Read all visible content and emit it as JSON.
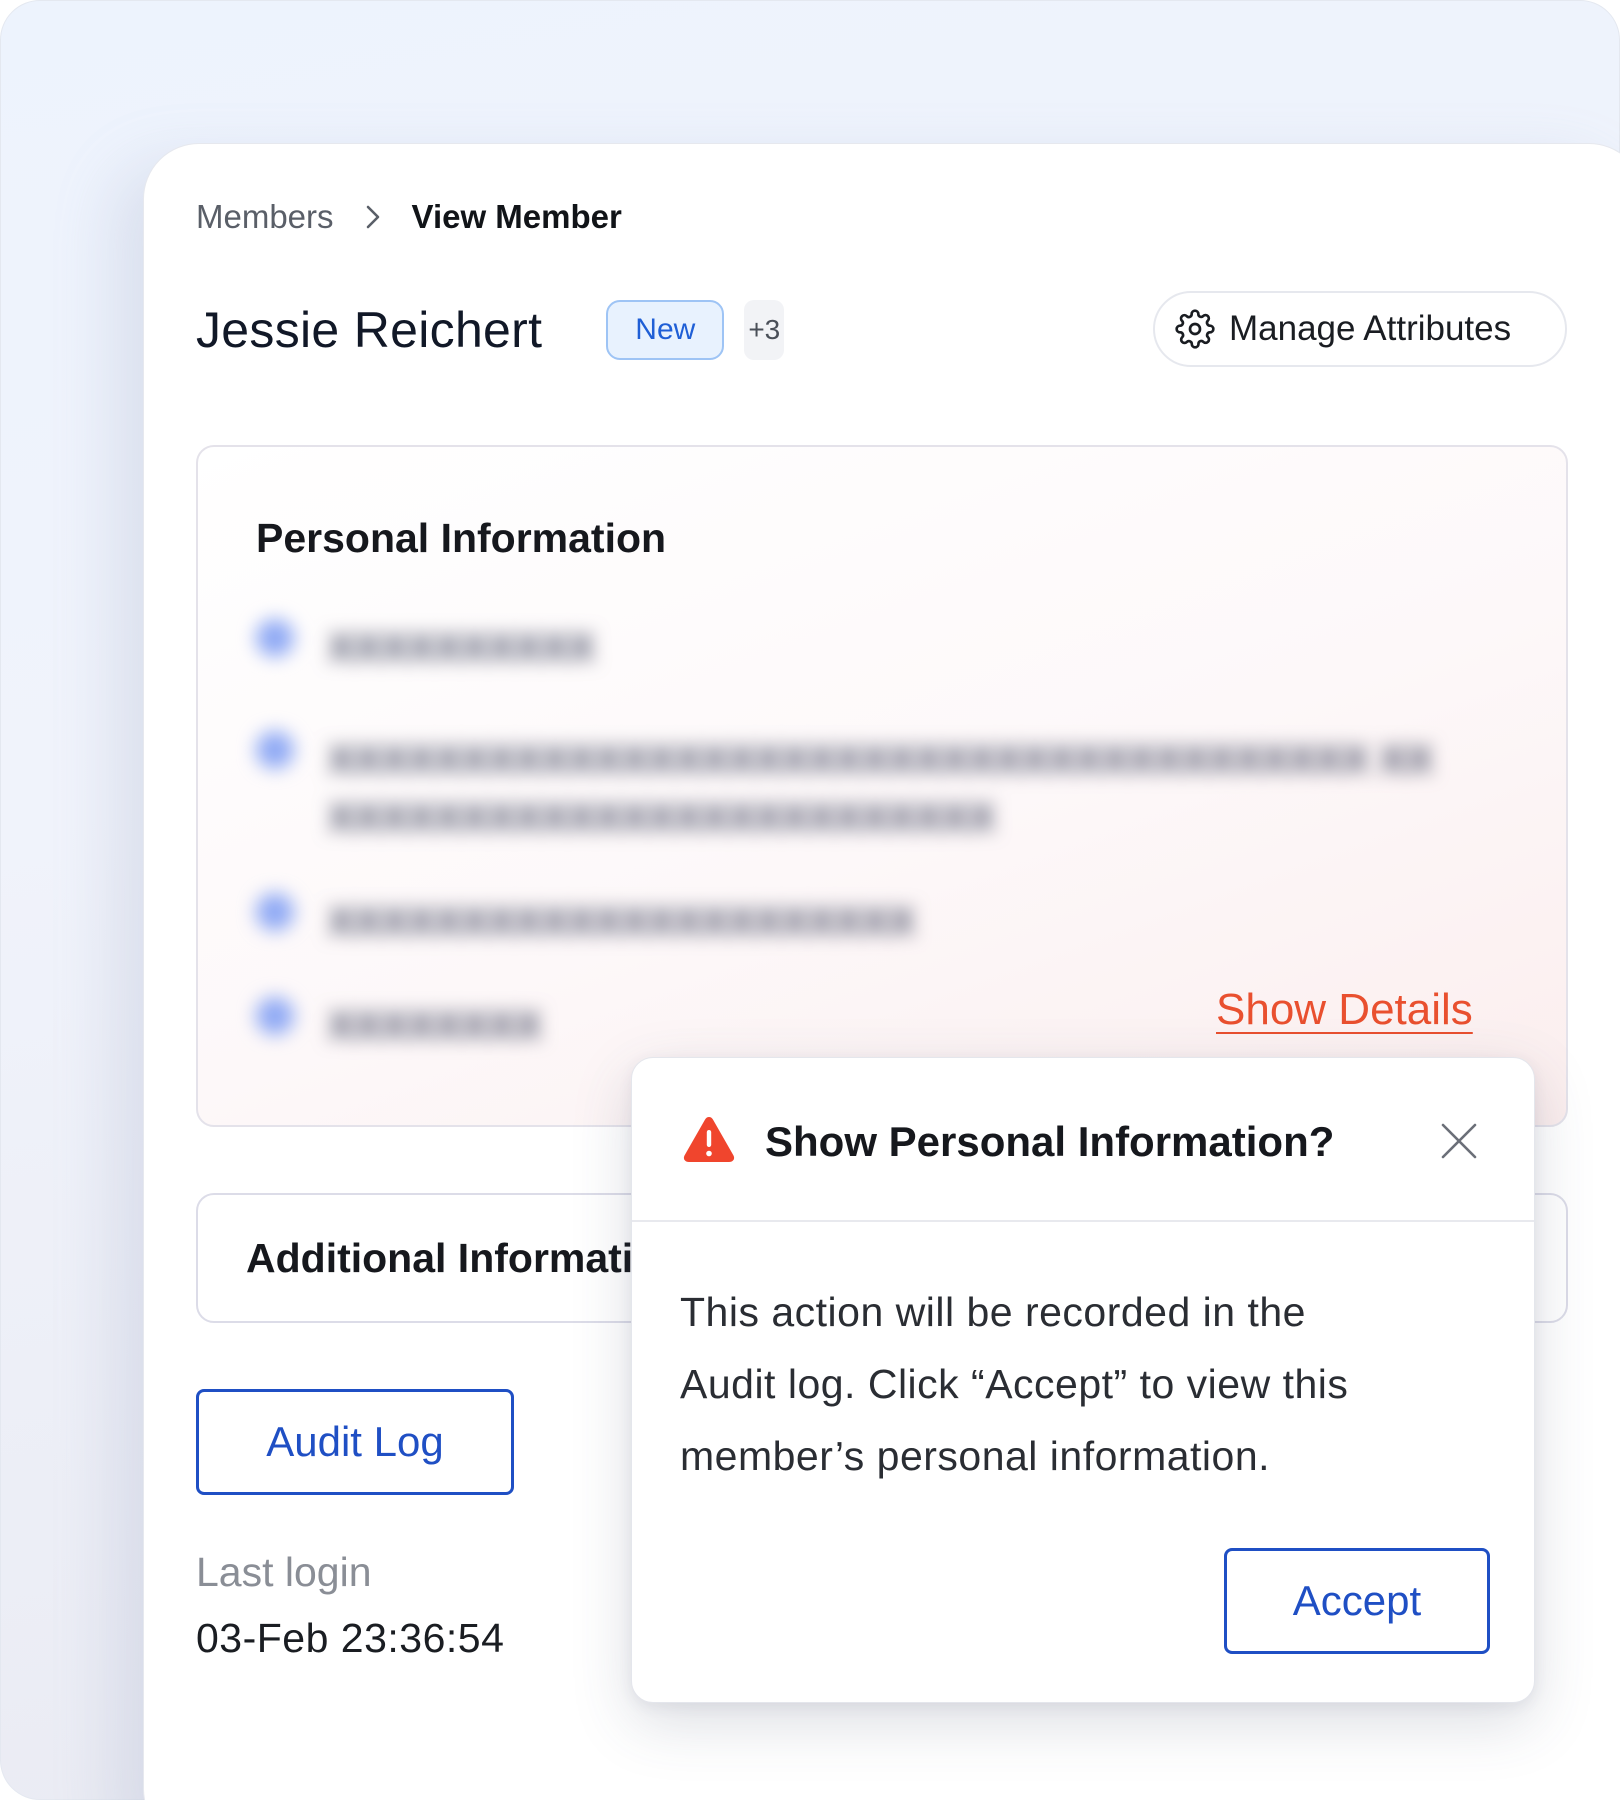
{
  "breadcrumb": {
    "parent": "Members",
    "current": "View Member"
  },
  "member": {
    "name": "Jessie Reichert",
    "badge": "New",
    "more_badges": "+3"
  },
  "header": {
    "manage_label": "Manage Attributes",
    "manage_icon": "gear-icon"
  },
  "personal_info": {
    "title": "Personal Information",
    "show_details": "Show Details",
    "redacted_rows": [
      {
        "icon": "phone-icon",
        "text": "XXXXXXXXXX"
      },
      {
        "icon": "location-icon",
        "text": "XXXXXXXXXXXXXXXXXXXXXXXXXXXXXXXXXXXXXXX XXXXXXXXXXXXXXXXXXXXXXXXXXX"
      },
      {
        "icon": "email-icon",
        "text": "XXXXXXXXXXXXXXXXXXXXXX"
      },
      {
        "icon": "calendar-icon",
        "text": "XXXXXXXX"
      }
    ]
  },
  "additional_info": {
    "title": "Additional Information"
  },
  "audit": {
    "button_label": "Audit Log"
  },
  "last_login": {
    "label": "Last login",
    "value": "03-Feb 23:36:54"
  },
  "modal": {
    "title": "Show Personal Information?",
    "body_line1": "This action will be recorded in the",
    "body_line2": "Audit log. Click “Accept” to view this",
    "body_line3": "member’s personal information.",
    "accept_label": "Accept",
    "warning_icon": "warning-icon",
    "close_icon": "close-icon"
  },
  "colors": {
    "accent_blue": "#1f4fc4",
    "link_red": "#e9502f",
    "warning_red": "#f0452d",
    "badge_blue": "#1f5fd6"
  }
}
